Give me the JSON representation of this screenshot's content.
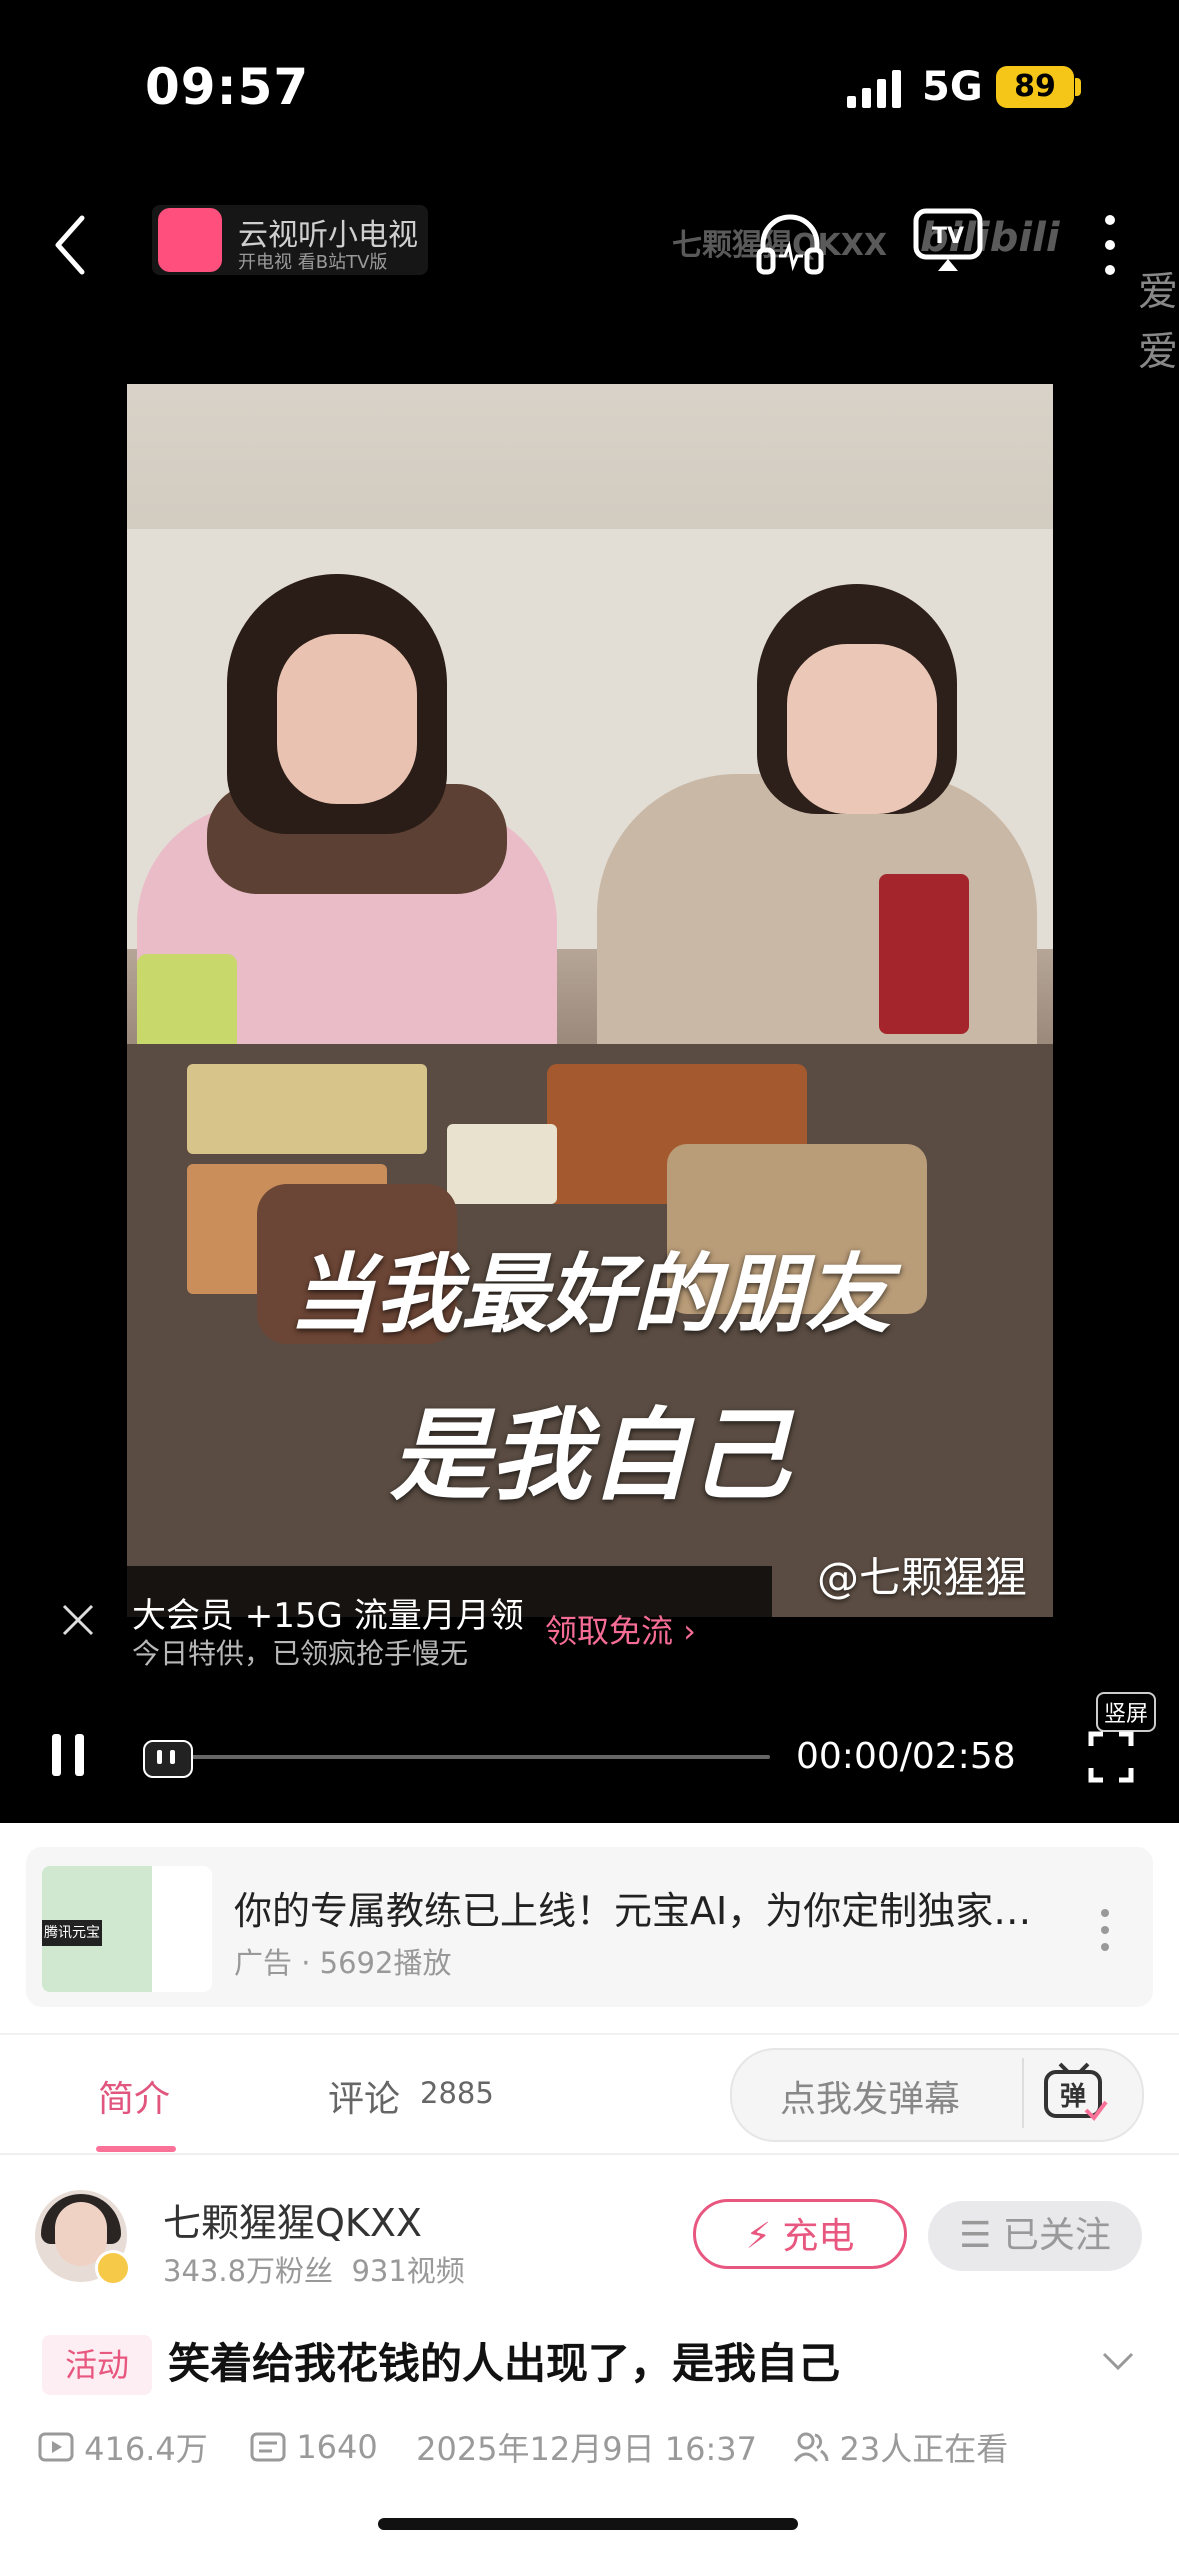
{
  "status_bar": {
    "time": "09:57",
    "network": "5G",
    "battery": "89"
  },
  "top_bar": {
    "promo_title": "云视听小电视",
    "promo_subtitle": "开电视 看B站TV版",
    "channel_watermark": "七颗猩猩QKXX",
    "platform_watermark": "bilibili",
    "side_text": "爱\n爱"
  },
  "video": {
    "overlay_line1": "当我最好的朋友",
    "overlay_line2": "是我自己",
    "handle": "@七颗猩猩"
  },
  "vip_banner": {
    "line1": "大会员 +15G 流量月月领",
    "line2": "今日特供，已领疯抢手慢无",
    "cta": "领取免流 ›"
  },
  "player_controls": {
    "time": "00:00/02:58",
    "vertical_label": "竖屏",
    "progress": 0
  },
  "ad": {
    "title": "你的专属教练已上线！元宝AI，为你定制独家…",
    "meta": "广告 · 5692播放",
    "thumb_tag": "腾讯元宝"
  },
  "tabs": {
    "intro": "简介",
    "comments": "评论",
    "comments_count": "2885",
    "danmu_placeholder": "点我发弹幕",
    "danmu_icon_label": "弹"
  },
  "uploader": {
    "name": "七颗猩猩QKXX",
    "stats": "343.8万粉丝  931视频",
    "charge_label": "⚡ 充电",
    "follow_label": "☰ 已关注"
  },
  "video_info": {
    "activity_tag": "活动",
    "title": "笑着给我花钱的人出现了，是我自己",
    "views": "416.4万",
    "danmaku": "1640",
    "date": "2025年12月9日 16:37",
    "watching": "23人正在看"
  },
  "colors": {
    "accent": "#fb7299",
    "accent_text": "#e8577f",
    "battery": "#f5c518"
  }
}
